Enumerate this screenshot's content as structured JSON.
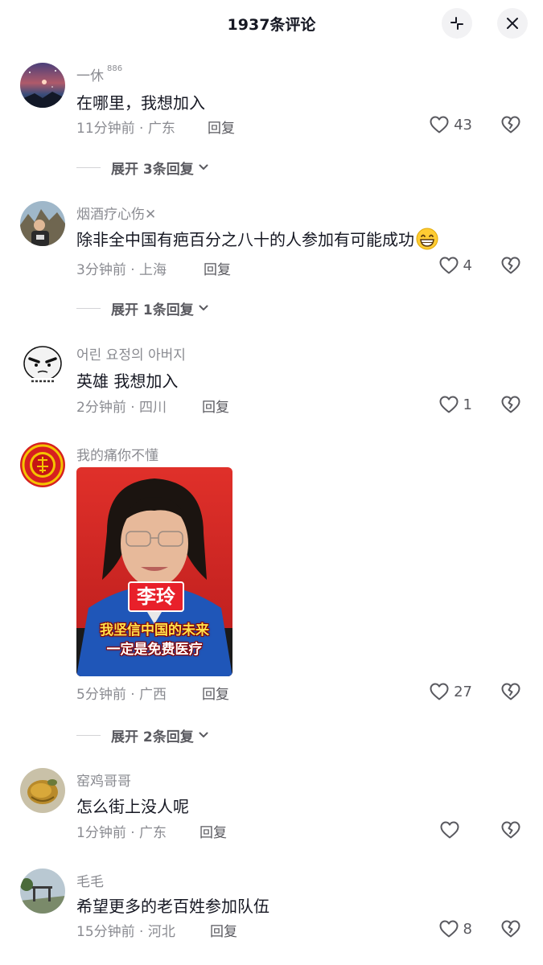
{
  "header": {
    "title": "1937条评论",
    "collapse_icon": "collapse-icon",
    "close_icon": "close-icon"
  },
  "comments": [
    {
      "username": "一休",
      "username_badge": "886",
      "text": "在哪里，我想加入",
      "time": "11分钟前 · 广东",
      "reply": "回复",
      "likes": "43",
      "expand": "展开 3条回复"
    },
    {
      "username": "烟酒疗心伤✕",
      "text": "除非全中国有疤百分之八十的人参加有可能成功",
      "emoji": "grinning-emoji",
      "time": "3分钟前 · 上海",
      "reply": "回复",
      "likes": "4",
      "expand": "展开 1条回复"
    },
    {
      "username": "어린 요정의 아버지",
      "text": "英雄 我想加入",
      "time": "2分钟前 · 四川",
      "reply": "回复",
      "likes": "1"
    },
    {
      "username": "我的痛你不懂",
      "image": {
        "name_label": "李玲",
        "caption_line1": "我坚信中国的未来",
        "caption_line2": "一定是免费医疗"
      },
      "time": "5分钟前 · 广西",
      "reply": "回复",
      "likes": "27",
      "expand": "展开 2条回复"
    },
    {
      "username": "窑鸡哥哥",
      "text": "怎么街上没人呢",
      "time": "1分钟前 · 广东",
      "reply": "回复",
      "likes": ""
    },
    {
      "username": "毛毛",
      "text": "希望更多的老百姓参加队伍",
      "time": "15分钟前 · 河北",
      "reply": "回复",
      "likes": "8"
    }
  ],
  "colors": {
    "primary_text": "#161823",
    "secondary_text": "#8a8b91",
    "action_text": "#59595f",
    "background": "#ffffff"
  }
}
